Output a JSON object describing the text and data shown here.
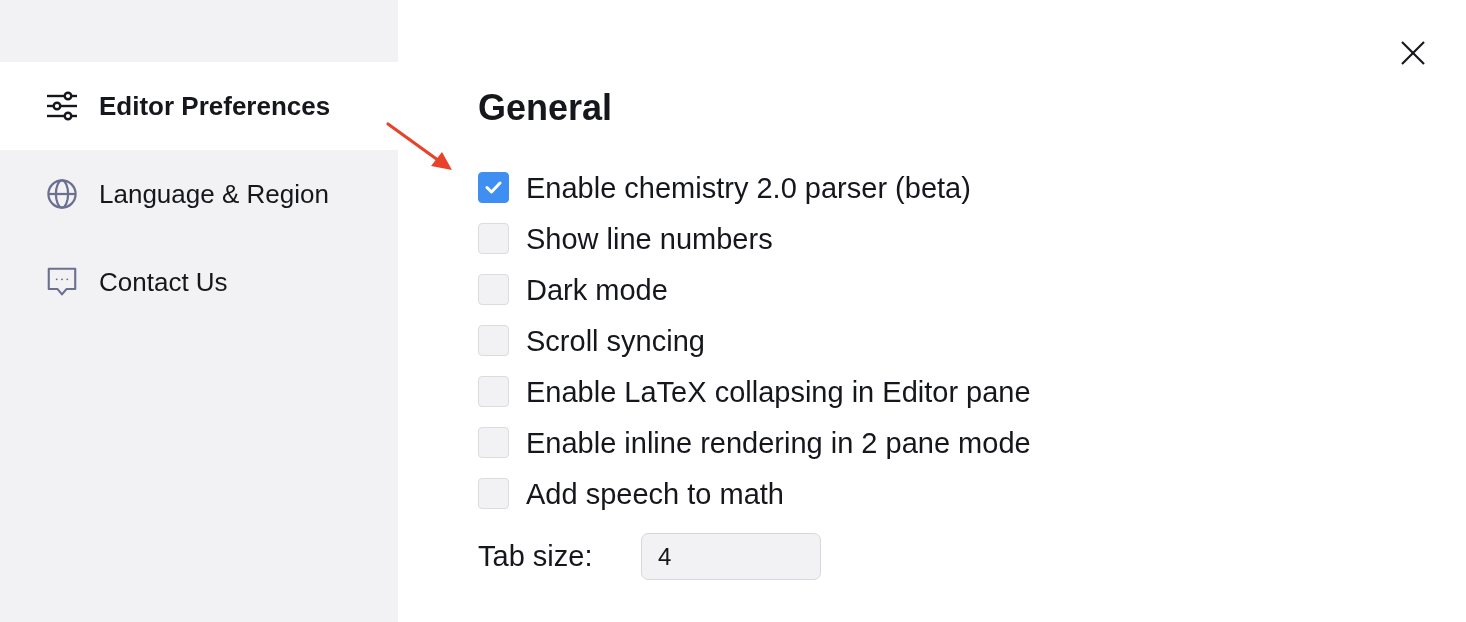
{
  "sidebar": {
    "items": [
      {
        "kind": "sliders",
        "label": "Editor Preferences",
        "selected": true
      },
      {
        "kind": "globe",
        "label": "Language & Region",
        "selected": false
      },
      {
        "kind": "chat",
        "label": "Contact Us",
        "selected": false
      }
    ]
  },
  "section": {
    "title": "General",
    "options": [
      {
        "label": "Enable chemistry 2.0 parser (beta)",
        "checked": true
      },
      {
        "label": "Show line numbers",
        "checked": false
      },
      {
        "label": "Dark mode",
        "checked": false
      },
      {
        "label": "Scroll syncing",
        "checked": false
      },
      {
        "label": "Enable LaTeX collapsing in Editor pane",
        "checked": false
      },
      {
        "label": "Enable inline rendering in 2 pane mode",
        "checked": false
      },
      {
        "label": "Add speech to math",
        "checked": false
      }
    ]
  },
  "tab_size": {
    "label": "Tab size:",
    "value": "4"
  }
}
